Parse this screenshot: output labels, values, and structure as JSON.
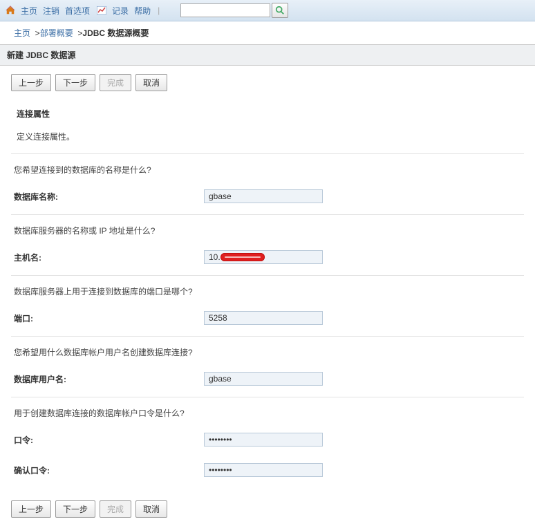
{
  "nav": {
    "home": "主页",
    "logout": "注销",
    "prefs": "首选项",
    "log": "记录",
    "help": "帮助"
  },
  "search": {
    "value": ""
  },
  "breadcrumb": {
    "home": "主页",
    "deploy": "部署概要",
    "current": "JDBC 数据源概要"
  },
  "section_title": "新建 JDBC 数据源",
  "buttons": {
    "back": "上一步",
    "next": "下一步",
    "finish": "完成",
    "cancel": "取消"
  },
  "props": {
    "title": "连接属性",
    "desc": "定义连接属性。"
  },
  "fields": {
    "dbname": {
      "q": "您希望连接到的数据库的名称是什么?",
      "label": "数据库名称:",
      "value": "gbase"
    },
    "host": {
      "q": "数据库服务器的名称或 IP 地址是什么?",
      "label": "主机名:",
      "value": "10."
    },
    "port": {
      "q": "数据库服务器上用于连接到数据库的端口是哪个?",
      "label": "端口:",
      "value": "5258"
    },
    "user": {
      "q": "您希望用什么数据库帐户用户名创建数据库连接?",
      "label": "数据库用户名:",
      "value": "gbase"
    },
    "pass": {
      "q": "用于创建数据库连接的数据库帐户口令是什么?",
      "label": "口令:",
      "value": "••••••••"
    },
    "confirm": {
      "label": "确认口令:",
      "value": "••••••••"
    }
  }
}
